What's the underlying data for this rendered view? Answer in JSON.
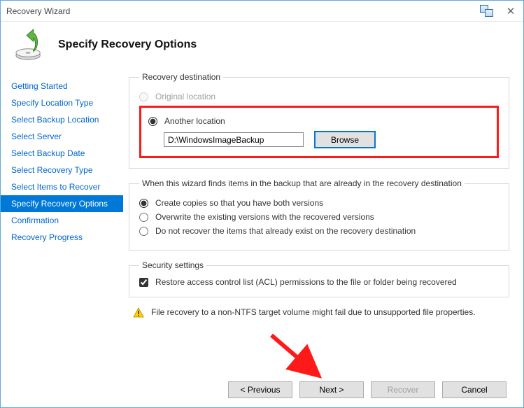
{
  "window": {
    "title": "Recovery Wizard"
  },
  "page": {
    "heading": "Specify Recovery Options"
  },
  "sidebar": {
    "items": [
      {
        "label": "Getting Started"
      },
      {
        "label": "Specify Location Type"
      },
      {
        "label": "Select Backup Location"
      },
      {
        "label": "Select Server"
      },
      {
        "label": "Select Backup Date"
      },
      {
        "label": "Select Recovery Type"
      },
      {
        "label": "Select Items to Recover"
      },
      {
        "label": "Specify Recovery Options"
      },
      {
        "label": "Confirmation"
      },
      {
        "label": "Recovery Progress"
      }
    ],
    "selected_index": 7
  },
  "destination": {
    "legend": "Recovery destination",
    "original_label": "Original location",
    "another_label": "Another location",
    "selected": "another",
    "path_value": "D:\\WindowsImageBackup",
    "browse_label": "Browse"
  },
  "conflict": {
    "legend": "When this wizard finds items in the backup that are already in the recovery destination",
    "copies_label": "Create copies so that you have both versions",
    "overwrite_label": "Overwrite the existing versions with the recovered versions",
    "skip_label": "Do not recover the items that already exist on the recovery destination",
    "selected": "copies"
  },
  "security": {
    "legend": "Security settings",
    "acl_label": "Restore access control list (ACL) permissions to the file or folder being recovered",
    "acl_checked": true
  },
  "warning": {
    "text": "File recovery to a non-NTFS target volume might fail due to unsupported file properties."
  },
  "footer": {
    "previous": "< Previous",
    "next": "Next >",
    "recover": "Recover",
    "cancel": "Cancel"
  }
}
